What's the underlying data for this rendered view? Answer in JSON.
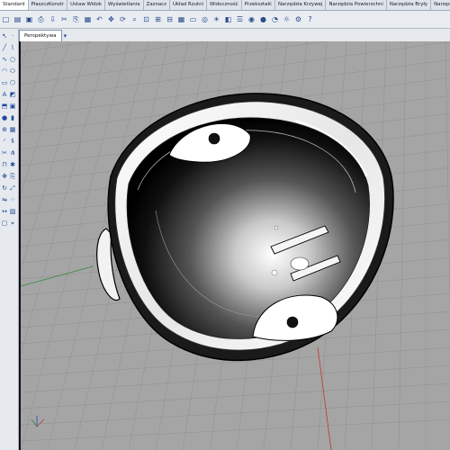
{
  "ribbon_tabs": [
    {
      "label": "Standard"
    },
    {
      "label": "PłaszczKonstr"
    },
    {
      "label": "Ustaw Widok"
    },
    {
      "label": "Wyświetlanie"
    },
    {
      "label": "Zaznacz"
    },
    {
      "label": "Układ Rzutni"
    },
    {
      "label": "Widoczność"
    },
    {
      "label": "Przekształć"
    },
    {
      "label": "Narzędzia Krzywej"
    },
    {
      "label": "Narzędzia Powierzchni"
    },
    {
      "label": "Narzędzia Bryły"
    },
    {
      "label": "Narzędzia Siatki"
    },
    {
      "label": "Narzędzia Render"
    }
  ],
  "viewport": {
    "tab_label": "Perspektywa",
    "background": "#a5a5a5",
    "grid_color": "#8f8f8f",
    "axis_x_color": "#c0392b",
    "axis_y_color": "#2e8b3a",
    "axis_z_color": "#1f4fd1"
  },
  "toolbar_icons": [
    "new-file-icon",
    "open-file-icon",
    "save-icon",
    "print-icon",
    "import-icon",
    "cut-icon",
    "copy-icon",
    "paste-icon",
    "undo-icon",
    "pan-icon",
    "rotate-view-icon",
    "zoom-icon",
    "zoom-window-icon",
    "zoom-extents-icon",
    "zoom-selected-icon",
    "grid-icon",
    "viewport-icon",
    "osnap-icon",
    "light-icon",
    "layer-icon",
    "properties-icon",
    "render-icon",
    "material-icon",
    "sphere-icon",
    "sun-icon",
    "settings-icon",
    "help-icon"
  ],
  "sidebar_icons": [
    "select-icon",
    "point-icon",
    "line-icon",
    "polyline-icon",
    "curve-icon",
    "circle-icon",
    "arc-icon",
    "ellipse-icon",
    "rectangle-icon",
    "polygon-icon",
    "text-icon",
    "surface-icon",
    "extrude-icon",
    "box-icon",
    "sphere-tool-icon",
    "cylinder-icon",
    "boolean-icon",
    "mesh-icon",
    "fillet-icon",
    "offset-icon",
    "trim-icon",
    "split-icon",
    "join-icon",
    "explode-icon",
    "move-icon",
    "copy-tool-icon",
    "rotate-icon",
    "scale-icon",
    "mirror-icon",
    "array-icon",
    "dimension-icon",
    "hatch-icon",
    "block-icon",
    "analyze-icon"
  ]
}
